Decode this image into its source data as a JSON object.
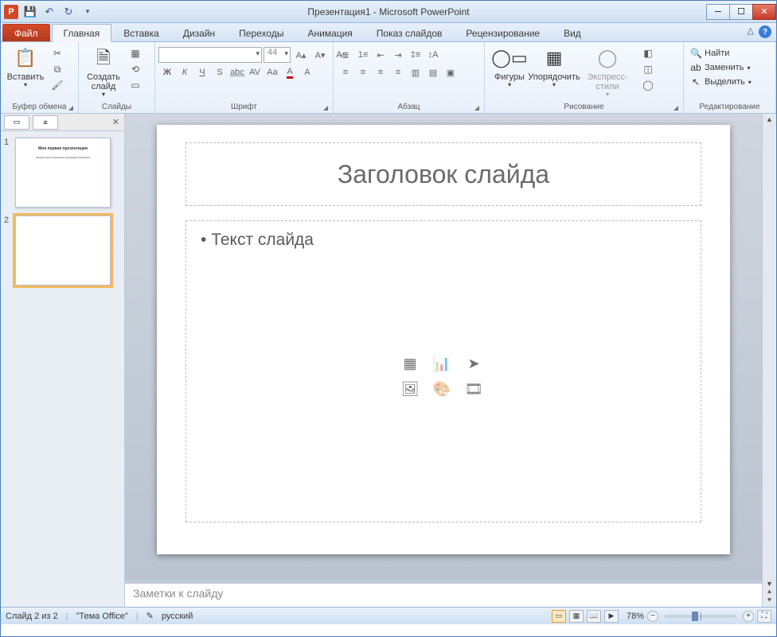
{
  "title": "Презентация1 - Microsoft PowerPoint",
  "tabs": {
    "file": "Файл",
    "home": "Главная",
    "insert": "Вставка",
    "design": "Дизайн",
    "transitions": "Переходы",
    "animations": "Анимация",
    "slideshow": "Показ слайдов",
    "review": "Рецензирование",
    "view": "Вид"
  },
  "groups": {
    "clipboard": "Буфер обмена",
    "slides": "Слайды",
    "font": "Шрифт",
    "paragraph": "Абзац",
    "drawing": "Рисование",
    "editing": "Редактирование"
  },
  "btn": {
    "paste": "Вставить",
    "newslide": "Создать\nслайд",
    "shapes": "Фигуры",
    "arrange": "Упорядочить",
    "quickstyles": "Экспресс-стили"
  },
  "font": {
    "name": "",
    "size": "44"
  },
  "edit": {
    "find": "Найти",
    "replace": "Заменить",
    "select": "Выделить"
  },
  "slideContent": {
    "titlePlaceholder": "Заголовок слайда",
    "bodyPlaceholder": "Текст слайда"
  },
  "thumb1": {
    "title": "Моя первая презентация",
    "sub": "Первые шаги в Освоении программы PowerPoint"
  },
  "notesPlaceholder": "Заметки к слайду",
  "status": {
    "slide": "Слайд 2 из 2",
    "theme": "\"Тема Office\"",
    "lang": "русский",
    "zoom": "78%"
  }
}
